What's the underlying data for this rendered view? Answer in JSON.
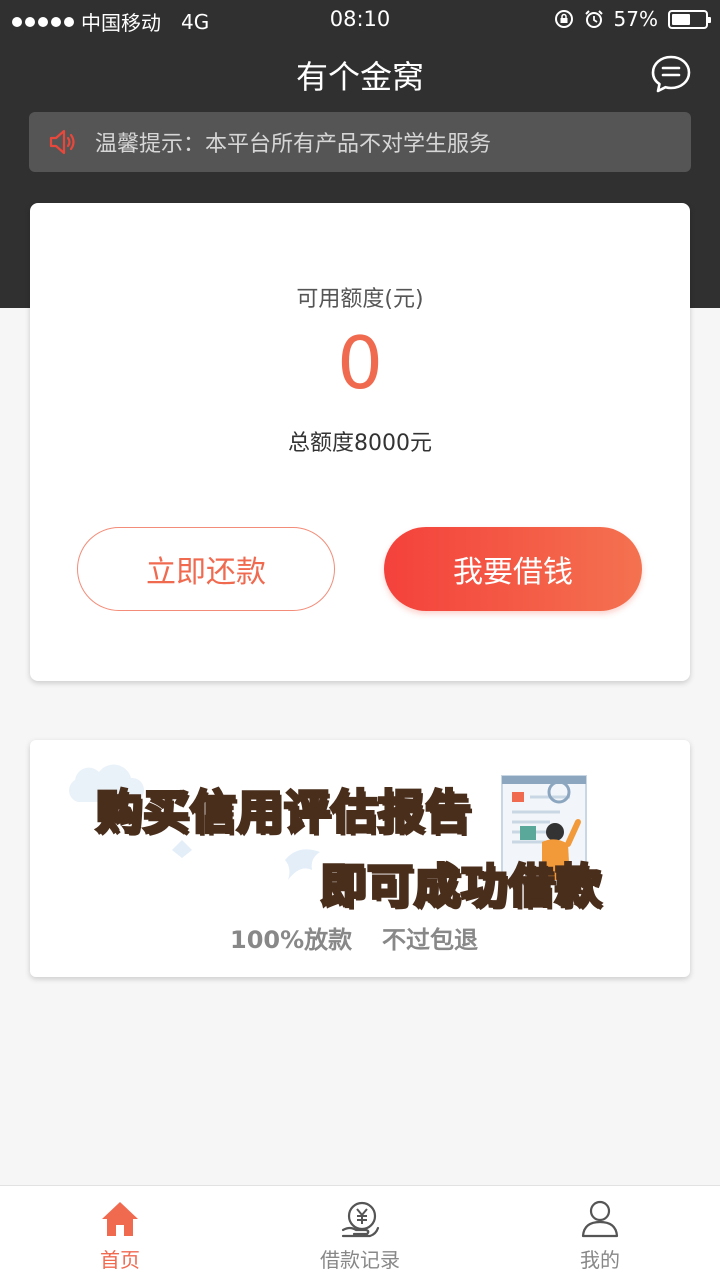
{
  "status_bar": {
    "carrier": "中国移动",
    "network": "4G",
    "time": "08:10",
    "battery": "57%",
    "battery_level": 0.57
  },
  "header": {
    "title": "有个金窝"
  },
  "notice": {
    "text": "温馨提示：本平台所有产品不对学生服务"
  },
  "credit": {
    "available_label": "可用额度(元)",
    "available_value": "0",
    "total_label": "总额度8000元",
    "repay_button": "立即还款",
    "borrow_button": "我要借钱"
  },
  "banner": {
    "line1_prefix": "购买",
    "line1_highlight": "信用评估报告",
    "line2": "即可成功借款",
    "sub1": "100%放款",
    "sub2": "不过包退"
  },
  "tabs": [
    {
      "label": "首页",
      "icon": "home-icon",
      "active": true
    },
    {
      "label": "借款记录",
      "icon": "loan-record-icon",
      "active": false
    },
    {
      "label": "我的",
      "icon": "user-icon",
      "active": false
    }
  ],
  "colors": {
    "accent": "#f06a50",
    "header_bg": "#303030",
    "page_bg": "#f6f6f6"
  }
}
